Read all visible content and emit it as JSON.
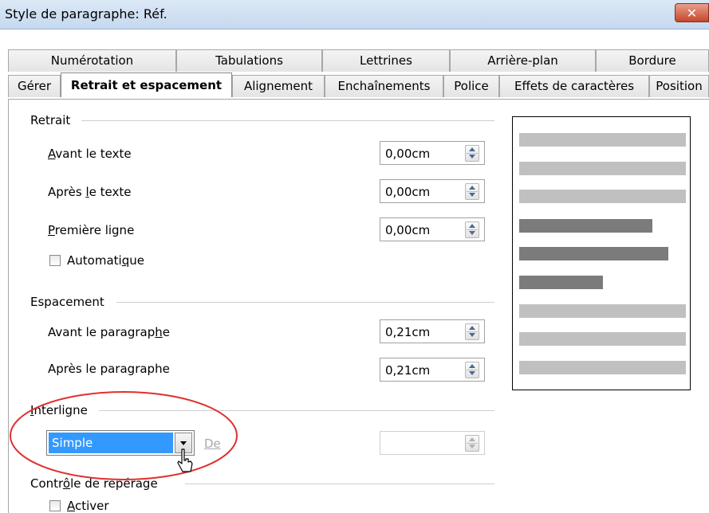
{
  "window": {
    "title": "Style de paragraphe: Réf.",
    "close_icon": "close-icon"
  },
  "tabs_row1": [
    "Numérotation",
    "Tabulations",
    "Lettrines",
    "Arrière-plan",
    "Bordure"
  ],
  "tabs_row2": [
    "Gérer",
    "Retrait et espacement",
    "Alignement",
    "Enchaînements",
    "Police",
    "Effets de caractères",
    "Position"
  ],
  "active_tab": "Retrait et espacement",
  "retrait": {
    "label": "Retrait",
    "avant_label_u": "A",
    "avant_label_rest": "vant le texte",
    "avant_value": "0,00cm",
    "apres_label_a": "Après ",
    "apres_label_u": "l",
    "apres_label_b": "e texte",
    "apres_value": "0,00cm",
    "premiere_label_u": "P",
    "premiere_label_rest": "remière ligne",
    "premiere_value": "0,00cm",
    "auto_label_a": "Automati",
    "auto_label_u": "q",
    "auto_label_b": "ue"
  },
  "espacement": {
    "label": "Espacement",
    "avant_label_a": "Avant le paragrap",
    "avant_label_u": "h",
    "avant_label_b": "e",
    "avant_value": "0,21cm",
    "apres_label_a": "Après le para",
    "apres_label_u": "g",
    "apres_label_b": "raphe",
    "apres_value": "0,21cm"
  },
  "interligne": {
    "label_u": "I",
    "label_rest": "nterligne",
    "selected": "Simple",
    "de_label": "De",
    "value": ""
  },
  "controle": {
    "label_a": "Contr",
    "label_u": "ô",
    "label_b": "le de repérage",
    "activer_label_u": "A",
    "activer_label_rest": "ctiver"
  },
  "colors": {
    "accent": "#3399ff",
    "highlight_ring": "#e03030",
    "preview_light": "#c0c0c0",
    "preview_dark": "#7b7b7b"
  }
}
